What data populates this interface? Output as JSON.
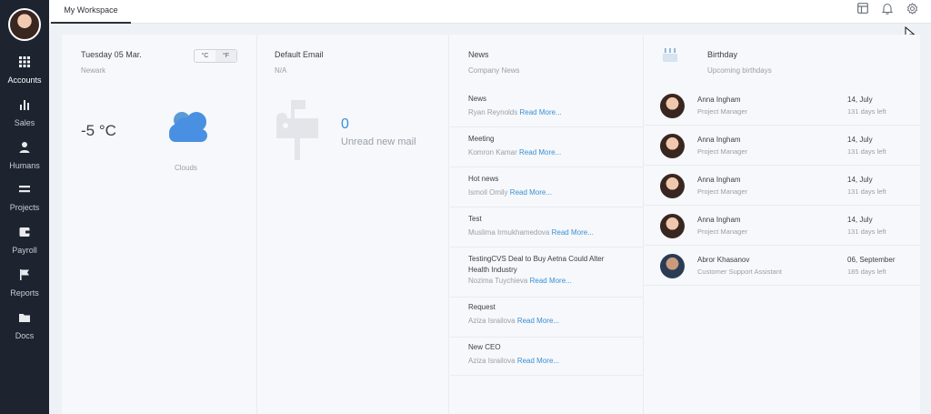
{
  "sidebar": {
    "items": [
      {
        "label": "Accounts",
        "icon": "grid-icon"
      },
      {
        "label": "Sales",
        "icon": "bar-chart-icon"
      },
      {
        "label": "Humans",
        "icon": "person-icon"
      },
      {
        "label": "Projects",
        "icon": "equals-icon"
      },
      {
        "label": "Payroll",
        "icon": "wallet-icon"
      },
      {
        "label": "Reports",
        "icon": "flag-icon"
      },
      {
        "label": "Docs",
        "icon": "folder-icon"
      }
    ]
  },
  "topbar": {
    "tab_label": "My Workspace",
    "icons": [
      "layout-icon",
      "bell-icon",
      "gear-icon"
    ]
  },
  "weather": {
    "date": "Tuesday 05 Mar.",
    "city": "Newark",
    "unit_c": "°C",
    "unit_f": "°F",
    "temperature": "-5 °C",
    "condition": "Clouds"
  },
  "email": {
    "title": "Default Email",
    "address": "N/A",
    "unread_count": "0",
    "unread_label": "Unread new mail"
  },
  "news": {
    "title": "News",
    "subtitle": "Company News",
    "read_more": "Read More...",
    "items": [
      {
        "title": "News",
        "author": "Ryan Reynolds"
      },
      {
        "title": "Meeting",
        "author": "Komron Kamar"
      },
      {
        "title": "Hot news",
        "author": "Ismoil Omily"
      },
      {
        "title": "Test",
        "author": "Muslima Irmukhamedova"
      },
      {
        "title": "TestingCVS Deal to Buy Aetna Could Alter Health Industry",
        "author": "Nozima Tuychieva"
      },
      {
        "title": "Request",
        "author": "Aziza Israilova"
      },
      {
        "title": "New CEO",
        "author": "Aziza Israilova"
      }
    ]
  },
  "birthday": {
    "title": "Birthday",
    "subtitle": "Upcoming birthdays",
    "people": [
      {
        "name": "Anna Ingham",
        "role": "Project Manager",
        "date": "14, July",
        "days_left": "131 days left"
      },
      {
        "name": "Anna Ingham",
        "role": "Project Manager",
        "date": "14, July",
        "days_left": "131 days left"
      },
      {
        "name": "Anna Ingham",
        "role": "Project Manager",
        "date": "14, July",
        "days_left": "131 days left"
      },
      {
        "name": "Anna Ingham",
        "role": "Project Manager",
        "date": "14, July",
        "days_left": "131 days left"
      },
      {
        "name": "Abror Khasanov",
        "role": "Customer Support Assistant",
        "date": "06, September",
        "days_left": "185 days left"
      }
    ]
  },
  "colors": {
    "sidebar_bg": "#1d2430",
    "accent": "#3b8fd6",
    "panel_bg": "#f6f8fb"
  }
}
